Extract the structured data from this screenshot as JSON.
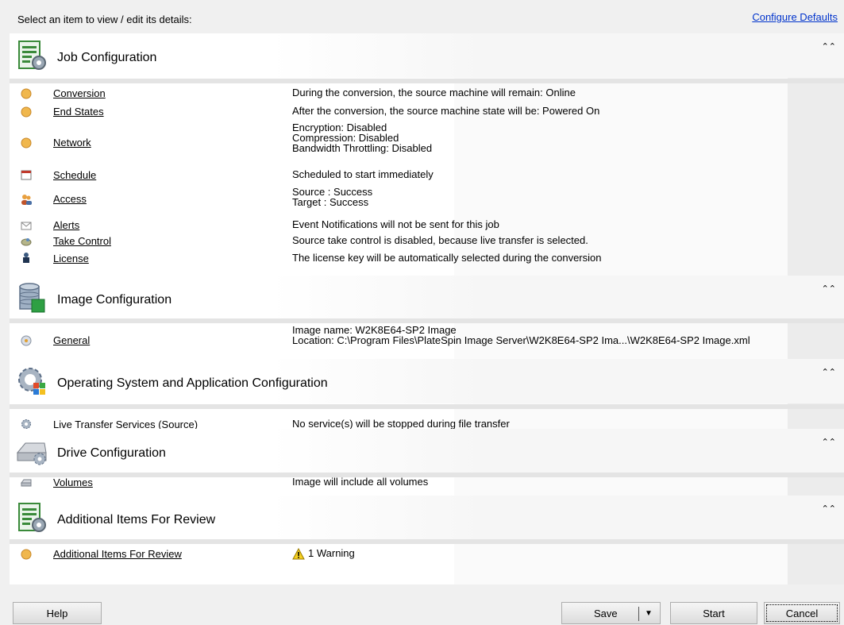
{
  "header": {
    "prompt": "Select an item to view / edit its details:",
    "configure_defaults": "Configure Defaults"
  },
  "sections": {
    "job": {
      "title": "Job Configuration",
      "icon": "config-sheet-icon",
      "items": {
        "conversion": {
          "label": "Conversion",
          "desc": "During the conversion, the source machine will remain: Online"
        },
        "end_states": {
          "label": "End States",
          "desc": "After the conversion, the source machine state will be: Powered On"
        },
        "network": {
          "label": "Network",
          "desc1": "Encryption: Disabled",
          "desc2": "Compression: Disabled",
          "desc3": "Bandwidth Throttling: Disabled"
        },
        "schedule": {
          "label": "Schedule",
          "desc": "Scheduled to start immediately"
        },
        "access": {
          "label": "Access",
          "desc1": "Source : Success",
          "desc2": "Target : Success"
        },
        "alerts": {
          "label": "Alerts",
          "desc": "Event Notifications will not be sent for this job"
        },
        "take_control": {
          "label": "Take Control",
          "desc": "Source take control is disabled, because live transfer is selected."
        },
        "license": {
          "label": "License",
          "desc": "The license key will be automatically selected during the conversion"
        }
      }
    },
    "image": {
      "title": "Image Configuration",
      "icon": "database-icon",
      "items": {
        "general": {
          "label": "General",
          "desc1": "Image name: W2K8E64-SP2 Image",
          "desc2": "Location:  C:\\Program  Files\\PlateSpin  Image  Server\\W2K8E64-SP2  Ima...\\W2K8E64-SP2 Image.xml"
        }
      }
    },
    "os": {
      "title": "Operating System and Application Configuration",
      "icon": "windows-gear-icon",
      "items": {
        "live_transfer": {
          "label": "Live Transfer Services (Source)",
          "desc": "No service(s) will be stopped during file transfer"
        }
      }
    },
    "drive": {
      "title": "Drive Configuration",
      "icon": "drive-gear-icon",
      "items": {
        "volumes": {
          "label": "Volumes",
          "desc": "Image will include all volumes"
        }
      }
    },
    "additional": {
      "title": "Additional Items For Review",
      "icon": "config-sheet-icon",
      "items": {
        "review": {
          "label": "Additional Items For Review",
          "desc": "1 Warning"
        }
      }
    }
  },
  "footer": {
    "help": "Help",
    "save": "Save",
    "start": "Start",
    "cancel": "Cancel"
  },
  "colors": {
    "link": "#0033cc",
    "divider": "#e4e4e4",
    "panel": "#ffffff",
    "window": "#f0f0f0"
  }
}
